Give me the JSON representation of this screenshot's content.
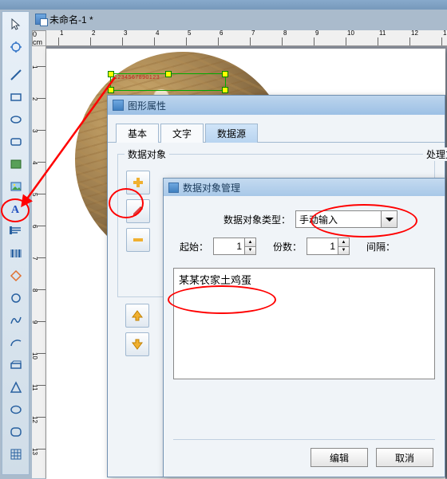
{
  "doc": {
    "title": "未命名-1 *"
  },
  "ruler": {
    "unit": "0 cm"
  },
  "selection": {
    "sample_text": "1234567890123"
  },
  "dialog1": {
    "title": "图形属性",
    "tabs": {
      "basic": "基本",
      "text": "文字",
      "datasource": "数据源"
    },
    "group": {
      "data_object": "数据对象",
      "process": "处理方"
    },
    "btns": {
      "add": "添加",
      "edit": "编辑",
      "delete": "删除",
      "up": "上移",
      "down": "下移"
    }
  },
  "dialog2": {
    "title": "数据对象管理",
    "labels": {
      "type": "数据对象类型：",
      "start": "起始：",
      "count": "份数：",
      "gap": "间隔："
    },
    "type_value": "手动输入",
    "start_value": "1",
    "count_value": "1",
    "content": "某某农家土鸡蛋",
    "buttons": {
      "edit": "编辑",
      "cancel": "取消"
    }
  },
  "tools": {
    "arrow": "arrow",
    "pan": "pan",
    "line": "line",
    "rect": "rect",
    "ellipse": "ellipse",
    "polygon": "polygon",
    "image": "image",
    "text": "text",
    "para": "para",
    "barcode": "barcode",
    "shape": "shape",
    "round": "round",
    "curve": "curve",
    "arc": "arc",
    "path": "path",
    "tri": "triangle",
    "oval": "oval",
    "roundrect": "roundrect",
    "grid": "grid"
  }
}
